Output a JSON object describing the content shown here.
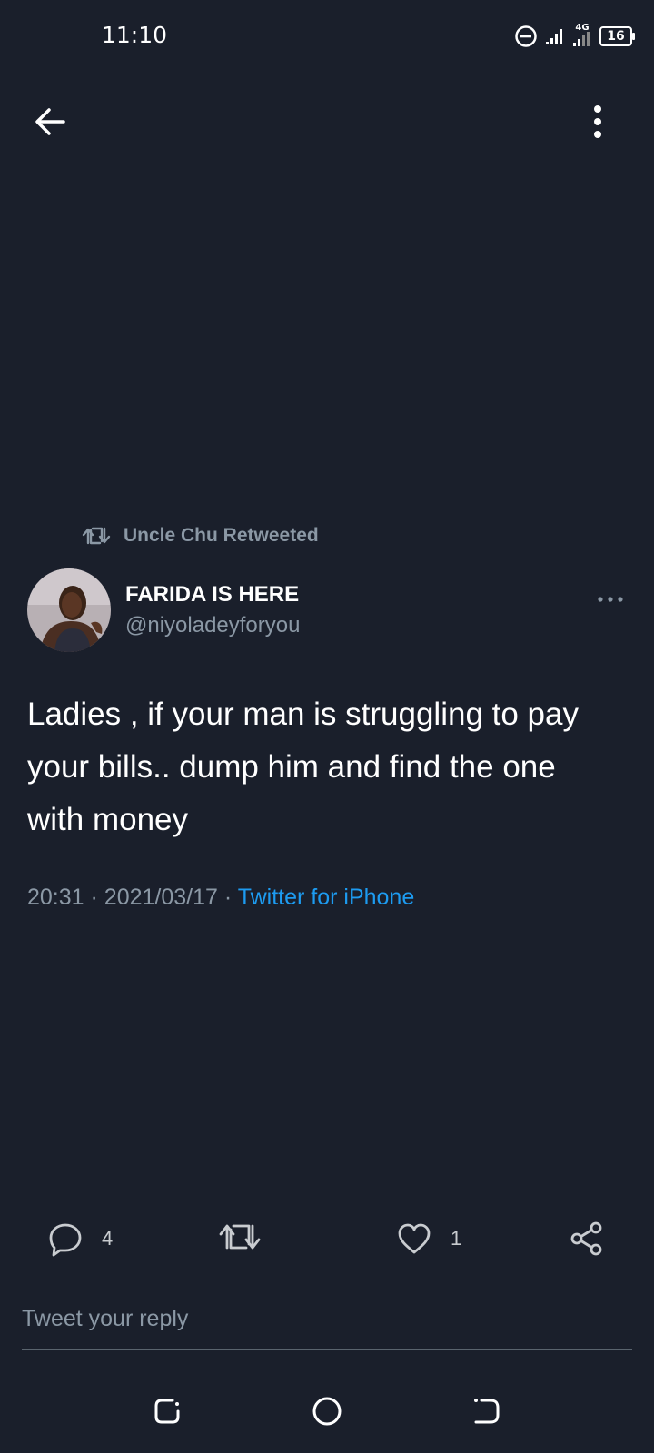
{
  "status_bar": {
    "time": "11:10",
    "network": "4G",
    "battery": "16"
  },
  "retweet": {
    "label": "Uncle Chu Retweeted"
  },
  "author": {
    "name": "FARIDA IS HERE",
    "handle": "@niyoladeyforyou"
  },
  "tweet": {
    "text": "Ladies , if your man is struggling to pay your bills.. dump him and find the one with money",
    "time": "20:31",
    "date": "2021/03/17",
    "source": "Twitter for iPhone",
    "separator": "·"
  },
  "actions": {
    "reply_count": "4",
    "like_count": "1"
  },
  "reply_box": {
    "placeholder": "Tweet your reply"
  },
  "colors": {
    "background": "#1a1f2b",
    "link": "#1d9bf0",
    "secondary_text": "#8b98a5"
  },
  "icons": [
    "back-arrow-icon",
    "more-vertical-icon",
    "retweet-icon",
    "more-horizontal-icon",
    "reply-icon",
    "like-icon",
    "share-icon",
    "dnd-icon",
    "signal-icon",
    "battery-icon"
  ]
}
